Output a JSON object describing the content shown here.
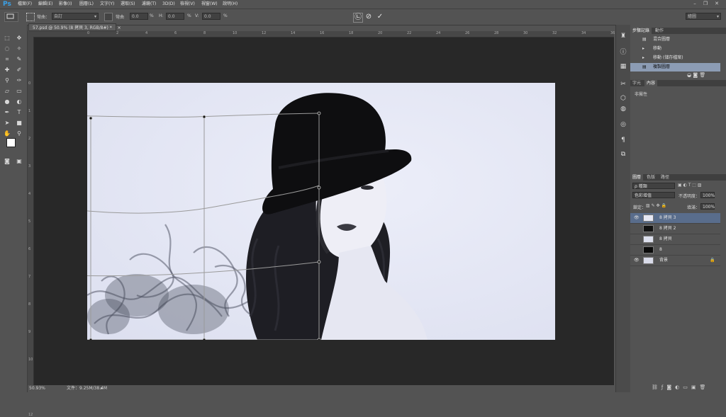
{
  "app": {
    "logo": "Ps"
  },
  "menu": [
    "檔案(F)",
    "編輯(E)",
    "影像(I)",
    "圖層(L)",
    "文字(Y)",
    "選取(S)",
    "濾鏡(T)",
    "3D(D)",
    "檢視(V)",
    "視窗(W)",
    "說明(H)"
  ],
  "window_controls": {
    "minimize": "–",
    "restore": "❐",
    "close": "✕"
  },
  "options_bar": {
    "warp_label": "彎曲：",
    "warp_value": "自訂",
    "bend_label": "彎曲",
    "bend_value": "0.0",
    "h_label": "H:",
    "h_value": "0.0",
    "v_label": "V:",
    "v_value": "0.0",
    "percent": "%",
    "workspace": "繪圖",
    "cancel_icon": "⊘",
    "commit_icon": "✓",
    "warp_mode_icon": "㉡"
  },
  "document": {
    "tab_title": "57.psd @ 50.9% (8 拷貝 3, RGB/8#) *",
    "tab_close": "×",
    "ruler_top": [
      "0",
      "2",
      "4",
      "6",
      "8",
      "10",
      "12",
      "14",
      "16",
      "18",
      "20",
      "22",
      "24",
      "26",
      "28",
      "30",
      "32",
      "34",
      "36",
      "38"
    ],
    "ruler_left": [
      "0",
      "1",
      "2",
      "3",
      "4",
      "5",
      "6",
      "7",
      "8",
      "9",
      "10",
      "11",
      "12"
    ]
  },
  "status": {
    "zoom": "50.93%",
    "doc_info": "文件：9.25M/38.4M"
  },
  "history_panel": {
    "tabs": [
      "步驟記錄",
      "動作"
    ],
    "items": [
      "混合圖層",
      "移動",
      "移動 (儲存檔案)",
      "複製圖層"
    ],
    "selected_index": 3
  },
  "character_panel": {
    "tabs": [
      "字元",
      "內容"
    ],
    "empty_text": "非屬性"
  },
  "layers_panel": {
    "tabs": [
      "圖層",
      "色版",
      "路徑"
    ],
    "filter_label": "ρ 種類",
    "blend_mode": "色彩增值",
    "opacity_label": "不透明度：",
    "opacity_value": "100%",
    "lock_label": "鎖定：",
    "fill_label": "填滿：",
    "fill_value": "100%",
    "layers": [
      {
        "name": "8 拷貝 3",
        "visible": true,
        "selected": true
      },
      {
        "name": "8 拷貝 2",
        "visible": false,
        "selected": false
      },
      {
        "name": "8 拷貝",
        "visible": false,
        "selected": false
      },
      {
        "name": "8",
        "visible": false,
        "selected": false
      },
      {
        "name": "背景",
        "visible": true,
        "selected": false,
        "locked": true
      }
    ]
  },
  "colors": {
    "accent": "#3aa0e6",
    "foreground": "#ffffff",
    "background": "#f2a11b",
    "selected_row": "#596d8c"
  }
}
